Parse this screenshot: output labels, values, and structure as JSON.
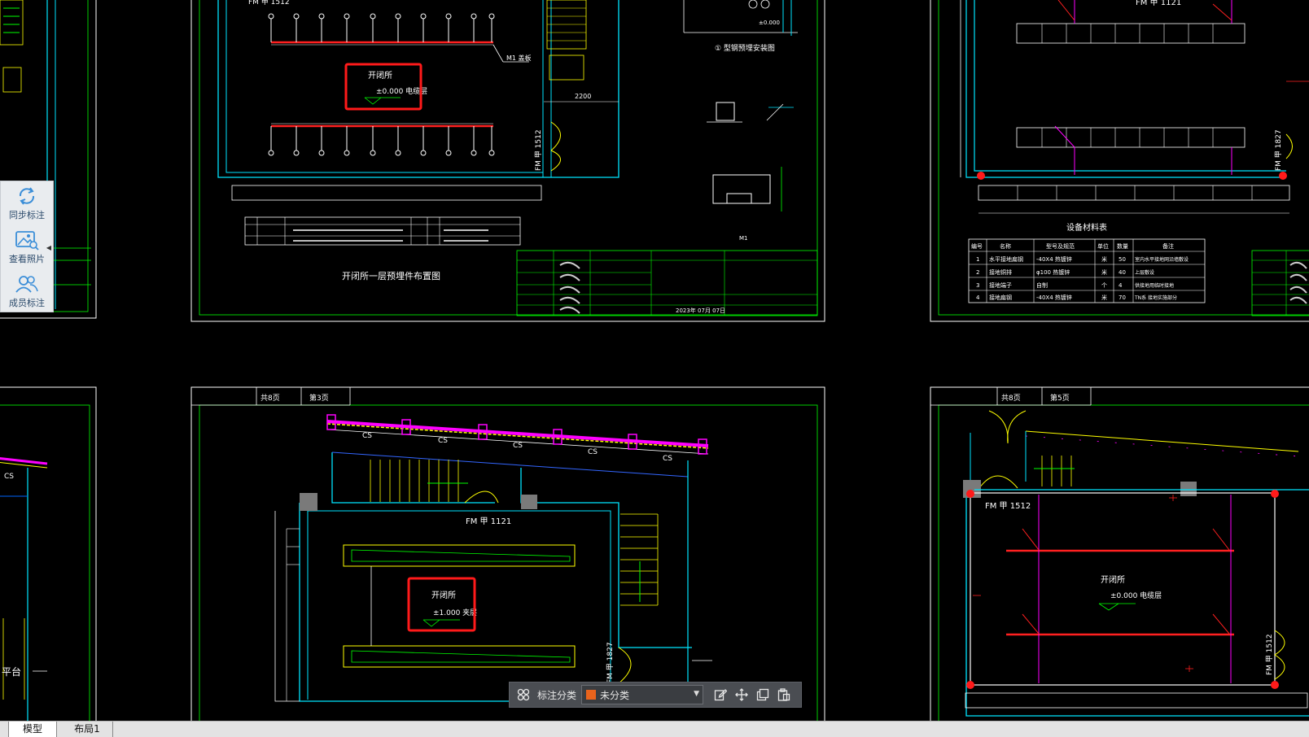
{
  "side_panel": {
    "items": [
      {
        "label": "同步标注",
        "icon": "sync-icon"
      },
      {
        "label": "查看照片",
        "icon": "photo-icon"
      },
      {
        "label": "成员标注",
        "icon": "members-icon"
      }
    ],
    "collapse_icon": "collapse-left-icon"
  },
  "toolbar": {
    "label": "标注分类",
    "category_value": "未分类",
    "category_color": "#e8631c",
    "icons": [
      "grid-icon",
      "edit-icon",
      "move-icon",
      "copy-icon",
      "paste-icon"
    ]
  },
  "tabs": [
    {
      "label": "模型",
      "active": true
    },
    {
      "label": "布局1",
      "active": false
    }
  ],
  "drawing": {
    "sheet1": {
      "title": "开闭所一层预埋件布置图",
      "door_top": "FM 甲 1512",
      "door_side": "FM 甲 1512",
      "callout": "M1 盖板",
      "room_name": "开闭所",
      "room_level": "±0.000 电缆层",
      "dim": "2200",
      "detail_title": "① 型钢预埋安装图",
      "detail_level": "±0.000",
      "detail_num": "M1",
      "date": "2023年 07月 07日"
    },
    "sheet2": {
      "door_top": "FM 甲 1121",
      "door_side": "FM 甲 1827",
      "table_title": "设备材料表",
      "table_header": [
        "编号",
        "名称",
        "型号及规范",
        "单位",
        "数量",
        "备注"
      ],
      "table_rows": [
        [
          "1",
          "水平接地扁钢",
          "-40X4 热镀锌",
          "米",
          "50",
          "室内水平接地网沿墙敷设"
        ],
        [
          "2",
          "接地铜排",
          "φ100 热镀锌",
          "米",
          "40",
          "上层敷设"
        ],
        [
          "3",
          "接地端子",
          "自制",
          "个",
          "4",
          "供接地用临时接地"
        ],
        [
          "4",
          "接地扁钢",
          "-40X4 热镀锌",
          "米",
          "70",
          "TN系 接地实施部分"
        ]
      ]
    },
    "sheet3": {
      "hdr": [
        "共8页",
        "第3页"
      ],
      "door": "FM 甲 1121",
      "door_side": "FM 甲 1827",
      "room_name": "开闭所",
      "room_level": "±1.000 夹层",
      "cs_labels": [
        "CS",
        "CS",
        "CS",
        "CS",
        "CS"
      ]
    },
    "sheet4": {
      "hdr": [
        "共8页",
        "第5页"
      ],
      "door_top": "FM 甲 1512",
      "door_side": "FM 甲 1512",
      "room_name": "开闭所",
      "room_level": "±0.000 电缆层"
    },
    "left_partial": {
      "platform": "平台",
      "cs": "CS"
    }
  }
}
